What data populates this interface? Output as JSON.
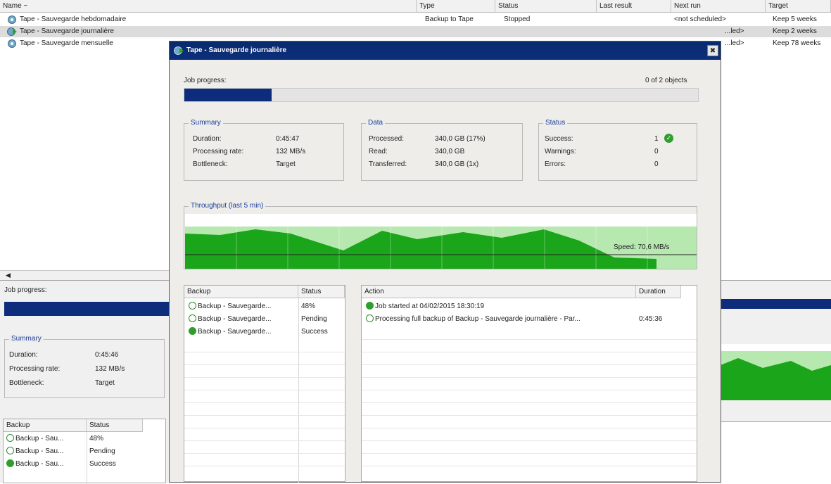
{
  "list": {
    "columns": [
      "Name  −",
      "Type",
      "Status",
      "Last result",
      "Next run",
      "Target"
    ],
    "rows": [
      {
        "name": "Tape - Sauvegarde hebdomadaire",
        "type": "Backup to Tape",
        "status": "Stopped",
        "last_result": "",
        "next_run": "<not scheduled>",
        "target": "Keep 5 weeks",
        "selected": false
      },
      {
        "name": "Tape - Sauvegarde journalière",
        "type": "",
        "status": "",
        "last_result": "",
        "next_run": "...led>",
        "target": "Keep 2 weeks",
        "selected": true
      },
      {
        "name": "Tape - Sauvegarde mensuelle",
        "type": "",
        "status": "",
        "last_result": "",
        "next_run": "...led>",
        "target": "Keep 78 weeks",
        "selected": false
      }
    ]
  },
  "dialog": {
    "title": "Tape - Sauvegarde journalière",
    "close_glyph": "✖",
    "job_progress_label": "Job progress:",
    "objects_text": "0 of 2 objects",
    "progress_value": 0.17,
    "summary": {
      "legend": "Summary",
      "duration_label": "Duration:",
      "duration": "0:45:47",
      "rate_label": "Processing rate:",
      "rate": "132 MB/s",
      "bottleneck_label": "Bottleneck:",
      "bottleneck": "Target"
    },
    "data": {
      "legend": "Data",
      "processed_label": "Processed:",
      "processed": "340,0 GB (17%)",
      "read_label": "Read:",
      "read": "340,0 GB",
      "transferred_label": "Transferred:",
      "transferred": "340,0 GB (1x)"
    },
    "status": {
      "legend": "Status",
      "success_label": "Success:",
      "success": "1",
      "warnings_label": "Warnings:",
      "warnings": "0",
      "errors_label": "Errors:",
      "errors": "0"
    },
    "throughput": {
      "legend": "Throughput (last 5 min)",
      "speed": "Speed: 70,6 MB/s"
    },
    "backup_table": {
      "headers": [
        "Backup",
        "Status"
      ],
      "rows": [
        {
          "name": "Backup - Sauvegarde...",
          "status": "48%",
          "icon": "running"
        },
        {
          "name": "Backup - Sauvegarde...",
          "status": "Pending",
          "icon": "running"
        },
        {
          "name": "Backup - Sauvegarde...",
          "status": "Success",
          "icon": "success"
        }
      ]
    },
    "action_table": {
      "headers": [
        "Action",
        "Duration"
      ],
      "rows": [
        {
          "text": "Job started at 04/02/2015 18:30:19",
          "duration": "",
          "icon": "success"
        },
        {
          "text": "Processing full backup of Backup - Sauvegarde journalière - Par...",
          "duration": "0:45:36",
          "icon": "running"
        }
      ]
    }
  },
  "bottom_panel": {
    "job_progress_label": "Job progress:",
    "summary": {
      "legend": "Summary",
      "duration_label": "Duration:",
      "duration": "0:45:46",
      "rate_label": "Processing rate:",
      "rate": "132 MB/s",
      "bottleneck_label": "Bottleneck:",
      "bottleneck": "Target"
    },
    "table": {
      "headers": [
        "Backup",
        "Status"
      ],
      "rows": [
        {
          "name": "Backup - Sau...",
          "status": "48%",
          "icon": "running"
        },
        {
          "name": "Backup - Sau...",
          "status": "Pending",
          "icon": "running"
        },
        {
          "name": "Backup - Sau...",
          "status": "Success",
          "icon": "success"
        }
      ]
    }
  },
  "colors": {
    "accent": "#0d2c7c",
    "chart_green": "#1aa51a",
    "chart_light": "#b7e8b0",
    "success": "#2f9e2f"
  }
}
